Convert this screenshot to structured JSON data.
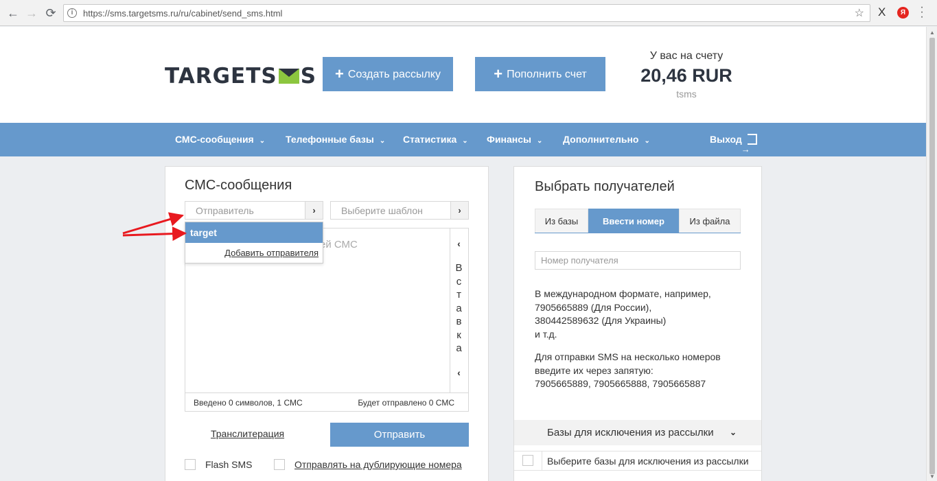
{
  "browser": {
    "back_icon": "←",
    "forward_icon": "→",
    "reload_icon": "⟳",
    "info_icon": "i",
    "url": "https://sms.targetsms.ru/ru/cabinet/send_sms.html",
    "star_icon": "☆",
    "ext_x_label": "X",
    "ext_yandex_label": "Я"
  },
  "header": {
    "logo_left": "TARGETS",
    "logo_right": "S",
    "create_campaign": "Создать рассылку",
    "top_up": "Пополнить счет",
    "plus": "+",
    "balance_label": "У вас на счету",
    "balance_value": "20,46 RUR",
    "username": "tsms"
  },
  "nav": {
    "items": [
      {
        "label": "СМС-сообщения"
      },
      {
        "label": "Телефонные базы"
      },
      {
        "label": "Статистика"
      },
      {
        "label": "Финансы"
      },
      {
        "label": "Дополнительно"
      }
    ],
    "chevron": "⌄",
    "logout": "Выход"
  },
  "sms_panel": {
    "title": "СМС-сообщения",
    "sender_placeholder": "Отправитель",
    "template_placeholder": "Выберите шаблон",
    "arrow": "›",
    "message_placeholder_visible": "ей СМС",
    "dropdown": {
      "selected": "target",
      "add_sender": "Добавить отправителя"
    },
    "insert_letters": [
      "В",
      "с",
      "т",
      "а",
      "в",
      "к",
      "а"
    ],
    "insert_chevron": "‹",
    "counter_entered": "Введено 0 символов, 1 СМС",
    "counter_will_send": "Будет отправлено 0 СМС",
    "transliteration": "Транслитерация",
    "send": "Отправить",
    "flash_sms": "Flash SMS",
    "send_duplicates": "Отправлять на дублирующие номера"
  },
  "recipients_panel": {
    "title": "Выбрать получателей",
    "tabs": [
      {
        "label": "Из базы",
        "active": false
      },
      {
        "label": "Ввести номер",
        "active": true
      },
      {
        "label": "Из файла",
        "active": false
      }
    ],
    "phone_placeholder": "Номер получателя",
    "help_1": "В международном формате, например,\n7905665889 (Для России),\n380442589632 (Для Украины)\nи т.д.",
    "help_2": "Для отправки SMS на несколько номеров\nвведите их через запятую:\n7905665889, 7905665888, 7905665887",
    "exclude_title": "Базы для исключения из рассылки",
    "exclude_chevron": "⌄",
    "exclude_select": "Выберите базы для исключения из рассылки"
  },
  "colors": {
    "accent": "#6699cc",
    "logo_green": "#8cc63f",
    "annotation_red": "#e8191f"
  }
}
